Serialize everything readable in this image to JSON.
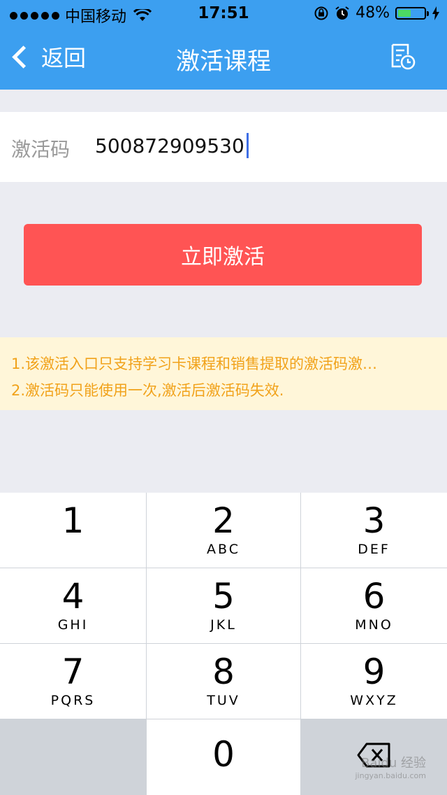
{
  "status_bar": {
    "carrier": "中国移动",
    "time": "17:51",
    "battery": "48%",
    "battery_level": 0.48
  },
  "nav": {
    "back_label": "返回",
    "title": "激活课程",
    "right_icon": "history-icon"
  },
  "form": {
    "code_label": "激活码",
    "code_value": "500872909530"
  },
  "activate_button": "立即激活",
  "notice": {
    "line1": "1.该激活入口只支持学习卡课程和销售提取的激活码激…",
    "line2": "2.激活码只能使用一次,激活后激活码失效."
  },
  "keypad": {
    "keys": [
      {
        "num": "1",
        "letters": ""
      },
      {
        "num": "2",
        "letters": "ABC"
      },
      {
        "num": "3",
        "letters": "DEF"
      },
      {
        "num": "4",
        "letters": "GHI"
      },
      {
        "num": "5",
        "letters": "JKL"
      },
      {
        "num": "6",
        "letters": "MNO"
      },
      {
        "num": "7",
        "letters": "PQRS"
      },
      {
        "num": "8",
        "letters": "TUV"
      },
      {
        "num": "9",
        "letters": "WXYZ"
      },
      {
        "num": "0",
        "letters": ""
      }
    ]
  },
  "watermark": {
    "text": "Baidu 经验",
    "url": "jingyan.baidu.com"
  },
  "colors": {
    "nav_bg": "#3c9ff0",
    "button_bg": "#ff5454",
    "notice_bg": "#fff6d9",
    "notice_text": "#f1a21a"
  }
}
